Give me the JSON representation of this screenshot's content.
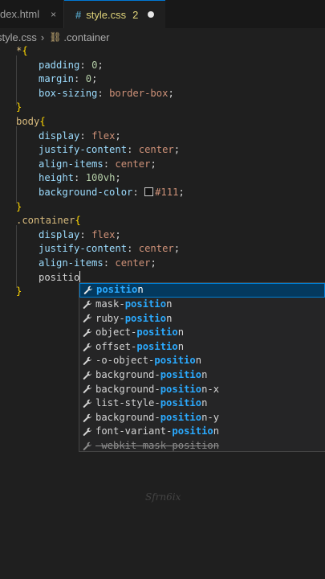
{
  "tabs": [
    {
      "label": "dex.html",
      "close": "×"
    },
    {
      "label": "style.css",
      "icon_text": "#",
      "problems": "2"
    }
  ],
  "breadcrumb": {
    "file": "style.css",
    "separator": "›",
    "symbol": ".container"
  },
  "code": {
    "l1_sel": "*",
    "l1_brace": "{",
    "l2_prop": "padding",
    "l2_val": "0",
    "l3_prop": "margin",
    "l3_val": "0",
    "l4_prop": "box-sizing",
    "l4_val": "border-box",
    "l5_brace": "}",
    "l6_sel": "body",
    "l6_brace": "{",
    "l7_prop": "display",
    "l7_val": "flex",
    "l8_prop": "justify-content",
    "l8_val": "center",
    "l9_prop": "align-items",
    "l9_val": "center",
    "l10_prop": "height",
    "l10_val": "100vh",
    "l11_prop": "background-color",
    "l11_val": "#111",
    "l12_brace": "}",
    "l13_sel": ".container",
    "l13_brace": "{",
    "l14_prop": "display",
    "l14_val": "flex",
    "l15_prop": "justify-content",
    "l15_val": "center",
    "l16_prop": "align-items",
    "l16_val": "center",
    "l17_typed": "positio",
    "l18_brace": "}"
  },
  "suggestions": [
    {
      "pre": "",
      "hl": "positio",
      "post": "n"
    },
    {
      "pre": "mask-",
      "hl": "positio",
      "post": "n"
    },
    {
      "pre": "ruby-",
      "hl": "positio",
      "post": "n"
    },
    {
      "pre": "object-",
      "hl": "positio",
      "post": "n"
    },
    {
      "pre": "offset-",
      "hl": "positio",
      "post": "n"
    },
    {
      "pre": "-o-object-",
      "hl": "positio",
      "post": "n"
    },
    {
      "pre": "background-",
      "hl": "positio",
      "post": "n"
    },
    {
      "pre": "background-",
      "hl": "positio",
      "post": "n-x"
    },
    {
      "pre": "list-style-",
      "hl": "positio",
      "post": "n"
    },
    {
      "pre": "background-",
      "hl": "positio",
      "post": "n-y"
    },
    {
      "pre": "font-variant-",
      "hl": "positio",
      "post": "n"
    },
    {
      "pre": "-webkit-mask-",
      "hl": "positio",
      "post": "n"
    }
  ],
  "watermark": "Sfrn6ix",
  "colors": {
    "accent": "#0078d4",
    "highlight": "#2aaaff",
    "selector": "#d7ba7d",
    "property": "#9cdcfe",
    "value": "#ce9178",
    "number": "#b5cea8",
    "brace": "#ffd700"
  }
}
